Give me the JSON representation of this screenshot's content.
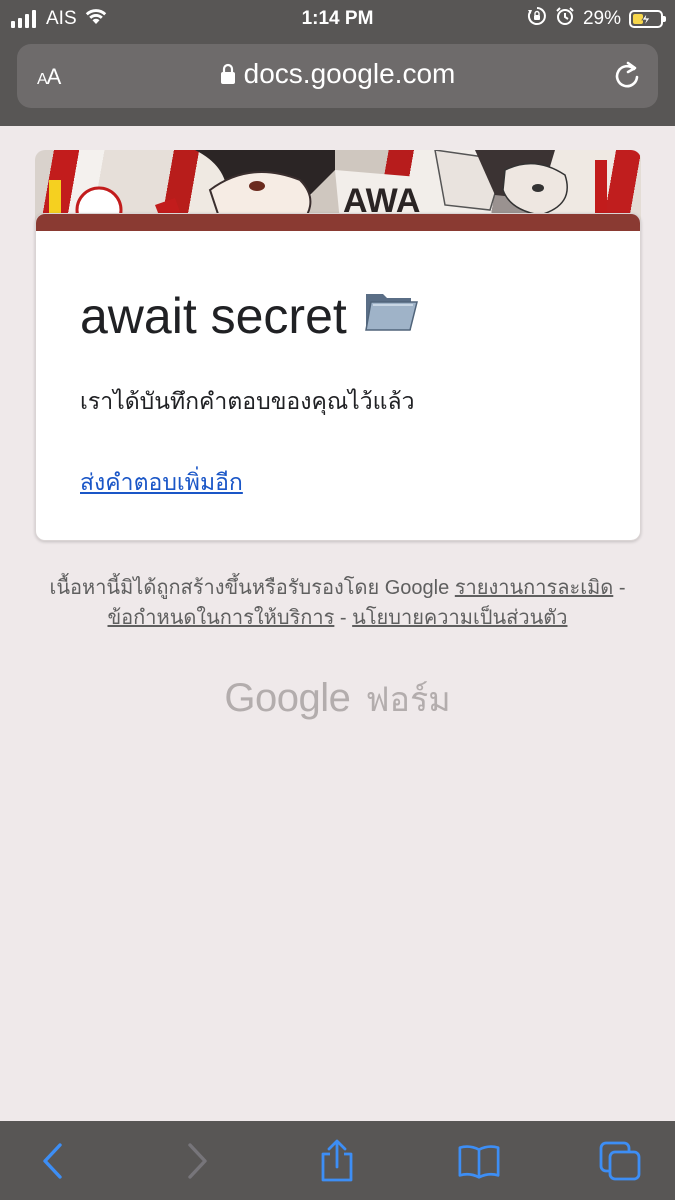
{
  "status_bar": {
    "carrier": "AIS",
    "time": "1:14 PM",
    "battery_percent": "29%",
    "battery_level": 0.29,
    "icons": [
      "signal-icon",
      "wifi-icon",
      "orientation-lock-icon",
      "alarm-icon",
      "battery-charging-icon"
    ]
  },
  "browser": {
    "text_size_label": "AA",
    "url": "docs.google.com",
    "lock_icon": "lock-icon",
    "reload_icon": "reload-icon"
  },
  "form": {
    "title": "await secret",
    "title_emoji": "open-folder-icon",
    "confirmation_message": "เราได้บันทึกคำตอบของคุณไว้แล้ว",
    "resubmit_link": "ส่งคำตอบเพิ่มอีก",
    "accent_color": "#8a3a32"
  },
  "footer": {
    "disclaimer_text": "เนื้อหานี้มิได้ถูกสร้างขึ้นหรือรับรองโดย Google",
    "report_abuse": "รายงานการละเมิด",
    "separator": " - ",
    "terms": "ข้อกำหนดในการให้บริการ",
    "privacy": "นโยบายความเป็นส่วนตัว",
    "logo_google": "Google",
    "logo_forms": "ฟอร์ม"
  },
  "toolbar": {
    "buttons": [
      "back-icon",
      "forward-icon",
      "share-icon",
      "bookmarks-icon",
      "tabs-icon"
    ]
  },
  "colors": {
    "chrome": "#585655",
    "url_bar": "#6e6b6b",
    "page_bg": "#efe9ea",
    "link": "#1a56c7",
    "ios_blue": "#3d8ef5"
  }
}
